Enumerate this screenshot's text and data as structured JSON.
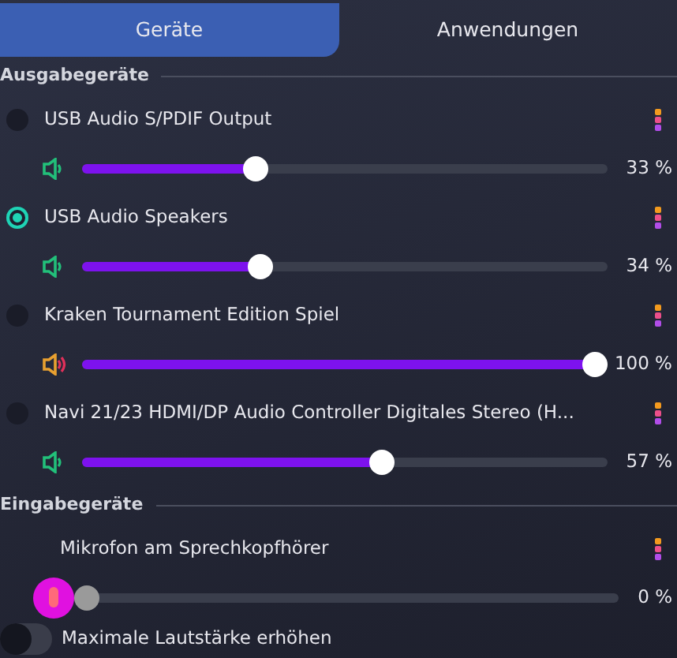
{
  "tabs": [
    {
      "label": "Geräte",
      "selected": true
    },
    {
      "label": "Anwendungen",
      "selected": false
    }
  ],
  "output_section": {
    "title": "Ausgabegeräte",
    "devices": [
      {
        "name": "USB Audio S/PDIF Output",
        "selected": false,
        "level": 0.33,
        "reading": "33 %"
      },
      {
        "name": "USB Audio Speakers",
        "selected": true,
        "level": 0.34,
        "reading": "34 %"
      },
      {
        "name": "Kraken Tournament Edition Spiel",
        "selected": false,
        "level": 1.0,
        "reading": "100 %"
      },
      {
        "name": "Navi 21/23 HDMI/DP Audio Controller Digitales Stereo (H...",
        "selected": false,
        "level": 0.57,
        "reading": "57 %"
      }
    ]
  },
  "input_section": {
    "title": "Eingabegeräte",
    "devices": [
      {
        "name": "Mikrofon am Sprechkopfhörer",
        "level": 0,
        "reading": "0 %"
      }
    ]
  },
  "toggle": {
    "label": "Maximale Lautstärke erhöhen",
    "on": false
  }
}
